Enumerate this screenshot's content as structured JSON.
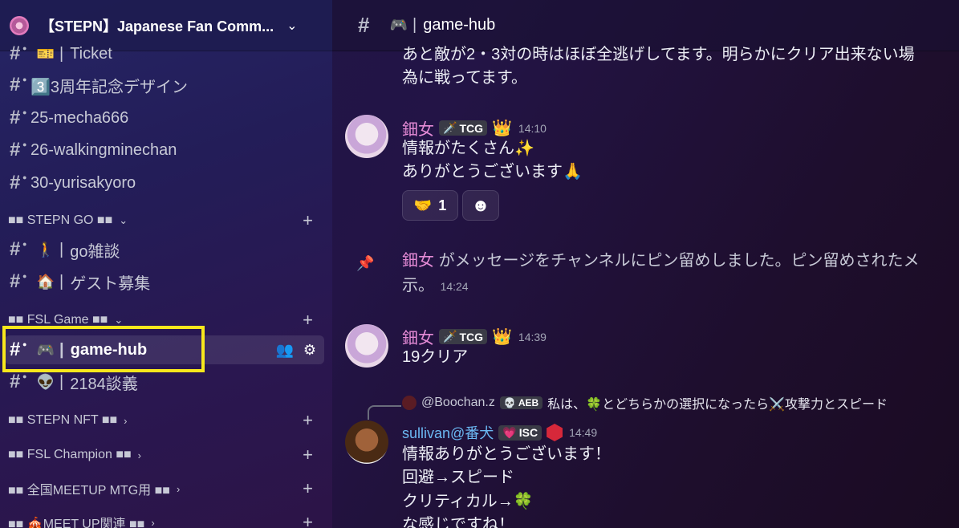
{
  "server": {
    "name": "【STEPN】Japanese Fan Comm...",
    "chevron": "⌄"
  },
  "sidebar": {
    "channels_top": [
      {
        "emoji": "🎫",
        "pipe": "|",
        "name": "Ticket"
      },
      {
        "emoji": "",
        "pipe": "",
        "name": "3️⃣3周年記念デザイン"
      },
      {
        "emoji": "",
        "pipe": "",
        "name": "25-mecha666"
      },
      {
        "emoji": "",
        "pipe": "",
        "name": "26-walkingminechan"
      },
      {
        "emoji": "",
        "pipe": "",
        "name": "30-yurisakyoro"
      }
    ],
    "cat_stepn_go": {
      "label": "■■ STEPN GO ■■",
      "arrow": "⌄"
    },
    "stepn_go_channels": [
      {
        "emoji": "🚶",
        "pipe": "|",
        "name": "go雑談"
      },
      {
        "emoji": "🏠",
        "pipe": "|",
        "name": "ゲスト募集"
      }
    ],
    "cat_fsl_game": {
      "label": "■■ FSL Game ■■",
      "arrow": "⌄"
    },
    "active_channel": {
      "emoji": "🎮",
      "pipe": "|",
      "name": "game-hub"
    },
    "fsl_game_channels": [
      {
        "emoji": "👽",
        "pipe": "|",
        "name": "2184談義"
      }
    ],
    "cat_stepn_nft": {
      "label": "■■ STEPN NFT ■■",
      "arrow": "›"
    },
    "cat_fsl_champion": {
      "label": "■■ FSL Champion ■■",
      "arrow": "›"
    },
    "cat_meetup_mtg": {
      "label": "■■ 全国MEETUP MTG用 ■■",
      "arrow": "›"
    },
    "cat_meetup": {
      "label": "■■ 🎪MEET UP関連 ■■",
      "arrow": "›"
    },
    "plus": "+"
  },
  "channel_header": {
    "emoji": "🎮",
    "pipe": "|",
    "name": "game-hub"
  },
  "messages": {
    "partial_line1": "あと敵が2・3対の時はほぼ全逃げしてます。明らかにクリア出来ない場",
    "partial_line2": "為に戦ってます。",
    "m1": {
      "user": "鈿女",
      "tag": "TCG",
      "tag_icon": "🗡️",
      "crown": "👑",
      "time": "14:10",
      "lines": [
        "情報がたくさん✨",
        "ありがとうございます🙏"
      ],
      "reaction_emoji": "🤝",
      "reaction_count": "1",
      "add_reaction": "☻"
    },
    "pin": {
      "user": "鈿女",
      "text": "がメッセージをチャンネルにピン留めしました。ピン留めされたメ",
      "line2": "示。",
      "time": "14:24"
    },
    "m2": {
      "user": "鈿女",
      "tag": "TCG",
      "tag_icon": "🗡️",
      "crown": "👑",
      "time": "14:39",
      "lines": [
        "19クリア"
      ]
    },
    "reply": {
      "user": "@Boochan.z",
      "tag": "AEB",
      "tag_icon": "💀",
      "text": "私は、🍀とどちらかの選択になったら⚔️攻撃力とスピード"
    },
    "m3": {
      "user": "sullivan@番犬",
      "tag": "ISC",
      "tag_icon": "💗",
      "time": "14:49",
      "lines": [
        "情報ありがとうございます！",
        "回避→スピード",
        "クリティカル→🍀",
        "な感じですね！"
      ]
    }
  },
  "colors": {
    "highlight": "#f8e71c",
    "username_pink": "#e58bd6",
    "username_blue": "#6bb8f2"
  }
}
